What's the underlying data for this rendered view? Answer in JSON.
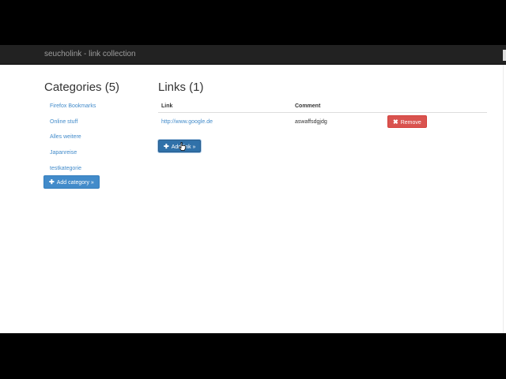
{
  "navbar": {
    "brand": "seucholink - link collection"
  },
  "categories": {
    "title": "Categories (5)",
    "items": [
      {
        "label": "Firefox Bookmarks"
      },
      {
        "label": "Online stuff"
      },
      {
        "label": "Alles weitere"
      },
      {
        "label": "Japanreise"
      },
      {
        "label": "testkategorie"
      }
    ],
    "add_button": "Add category »"
  },
  "links": {
    "title": "Links (1)",
    "columns": {
      "link": "Link",
      "comment": "Comment"
    },
    "rows": [
      {
        "link": "http://www.google.de",
        "comment": "aswaffsdgjdg",
        "remove_label": "Remove"
      }
    ],
    "add_button": "Add link »"
  },
  "icons": {
    "plus": "plus-icon",
    "remove": "x-icon",
    "cursor": "hand-cursor-icon"
  },
  "colors": {
    "primary": "#428bca",
    "danger": "#d9534f",
    "navbar": "#222222"
  }
}
